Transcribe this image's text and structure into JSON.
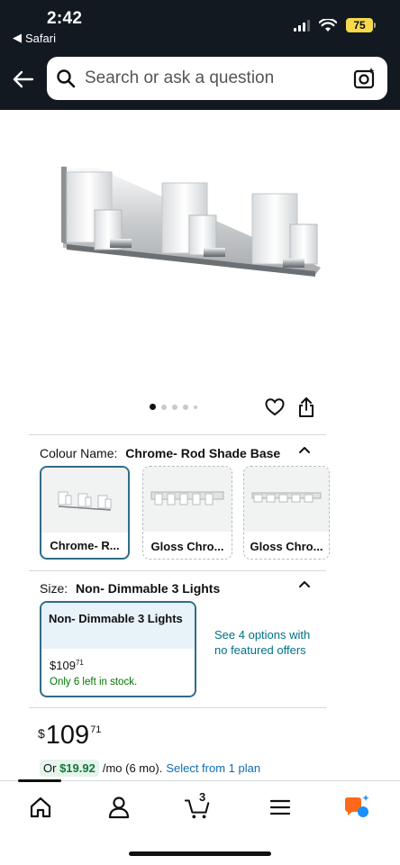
{
  "status": {
    "time": "2:42",
    "back_app": "Safari",
    "battery": "75"
  },
  "header": {
    "search_placeholder": "Search or ask a question"
  },
  "gallery": {
    "image_count": 5,
    "active_index": 0
  },
  "colour": {
    "label": "Colour Name:",
    "selected": "Chrome- Rod Shade Base",
    "options": [
      {
        "name": "Chrome- R..."
      },
      {
        "name": "Gloss Chro..."
      },
      {
        "name": "Gloss Chro..."
      }
    ]
  },
  "size": {
    "label": "Size:",
    "selected": "Non- Dimmable 3 Lights",
    "card": {
      "title": "Non- Dimmable 3 Lights",
      "price_symbol": "$",
      "price_whole": "109",
      "price_frac": "71",
      "stock": "Only 6 left in stock."
    },
    "see_options": "See 4 options with no featured offers"
  },
  "price": {
    "currency": "$",
    "whole": "109",
    "fraction": "71"
  },
  "plan": {
    "prefix": "Or",
    "amount": "$19.92",
    "term": "/mo (6 mo).",
    "link": "Select from 1 plan"
  },
  "nav": {
    "cart_count": "3",
    "items": [
      "home-icon",
      "account-icon",
      "cart-icon",
      "menu-icon",
      "rufus-ai-icon"
    ]
  },
  "colors": {
    "header_bg": "#131921",
    "selected_border": "#2e6c8a",
    "link": "#007185",
    "stock_green": "#007600",
    "battery": "#f7d94c",
    "rufus_orange": "#ff6a1a",
    "rufus_blue": "#1a8fff"
  }
}
